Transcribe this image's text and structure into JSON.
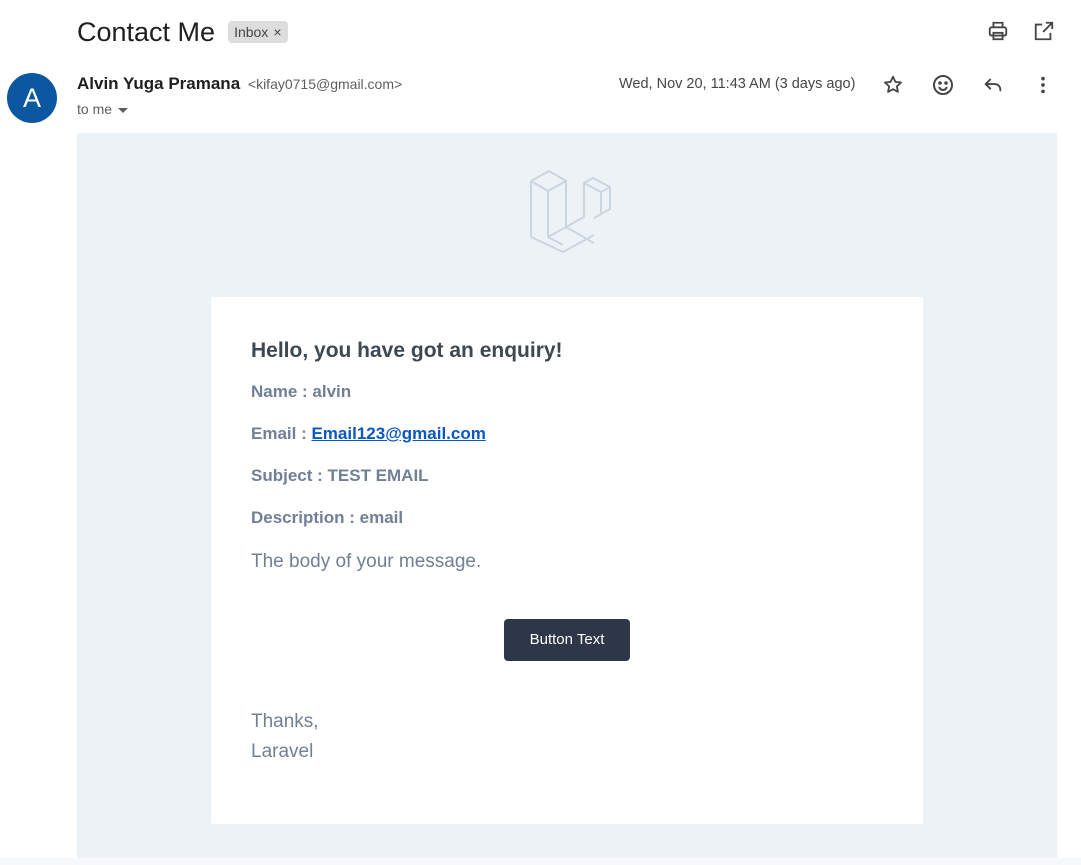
{
  "header": {
    "subject": "Contact Me",
    "label_chip": "Inbox",
    "label_remove": "×"
  },
  "message": {
    "avatar_letter": "A",
    "sender_name": "Alvin Yuga Pramana",
    "sender_email": "<kifay0715@gmail.com>",
    "to_text": "to me",
    "date": "Wed, Nov 20, 11:43 AM (3 days ago)"
  },
  "icons": {
    "print": "print-icon",
    "open_new_window": "open-in-new-window-icon",
    "star": "star-icon",
    "emoji": "emoji-reaction-icon",
    "reply": "reply-icon",
    "more": "more-vertical-icon",
    "logo": "laravel-logo-icon"
  },
  "email": {
    "greeting": "Hello, you have got an enquiry!",
    "name_line": "Name : alvin",
    "email_label": "Email : ",
    "email_link": "Email123@gmail.com",
    "subject_line": "Subject : TEST EMAIL",
    "description_line": "Description : email",
    "body_text": "The body of your message.",
    "button_label": "Button Text",
    "thanks": "Thanks,",
    "signature": "Laravel"
  },
  "colors": {
    "avatar": "#0b57a0",
    "email_background": "#edf2f7",
    "button": "#2d3748",
    "link": "#0b57c1",
    "muted_text": "#718096"
  }
}
